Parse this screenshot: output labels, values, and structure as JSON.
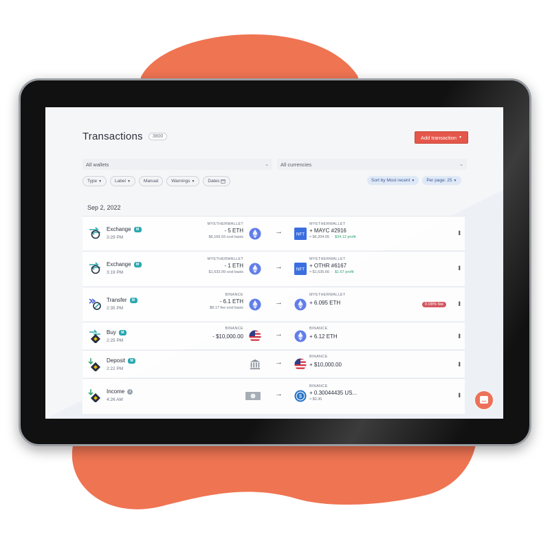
{
  "colors": {
    "blob": "#ef7452",
    "accent": "#e4574a",
    "teal": "#2aa8b0",
    "profit": "#2aa06e",
    "fee": "#d4545e"
  },
  "header": {
    "title": "Transactions",
    "count": "3800"
  },
  "add_button": {
    "label": "Add transaction"
  },
  "filters": {
    "wallets": "All wallets",
    "currencies": "All currencies",
    "chips": [
      "Type",
      "Label",
      "Manual",
      "Warnings",
      "Dates"
    ],
    "sort": "Sort by Most recent",
    "per_page": "Per page: 25"
  },
  "date_heading": "Sep 2, 2022",
  "transactions": [
    {
      "type": "Exchange",
      "badge": "M",
      "time": "3:29 PM",
      "icon": "exchange-icon",
      "src_wallet": "MYETHERWALLET",
      "src_amount": "- 5 ETH",
      "src_sub": "$6,169.93 cost basis",
      "src_coin": "eth-icon",
      "dst_wallet": "MYETHERWALLET",
      "dst_amount": "+ MAYC #2916",
      "dst_value": "≈ $6,204.05",
      "dst_profit": "$34.12 profit",
      "dst_coin": "nft-icon"
    },
    {
      "type": "Exchange",
      "badge": "M",
      "time": "3:19 PM",
      "icon": "exchange-icon",
      "src_wallet": "MYETHERWALLET",
      "src_amount": "- 1 ETH",
      "src_sub": "$1,633.99 cost basis",
      "src_coin": "eth-icon",
      "dst_wallet": "MYETHERWALLET",
      "dst_amount": "+ OTHR #6167",
      "dst_value": "≈ $1,635.66",
      "dst_profit": "$1.67 profit",
      "dst_coin": "nft-icon"
    },
    {
      "type": "Transfer",
      "badge": "M",
      "time": "2:35 PM",
      "icon": "transfer-icon",
      "src_wallet": "BINANCE",
      "src_amount": "- 6.1 ETH",
      "src_sub": "$8.17 fee cost basis",
      "src_coin": "eth-icon",
      "dst_wallet": "MYETHERWALLET",
      "dst_amount": "+ 6.095 ETH",
      "dst_coin": "eth-icon",
      "fee_badge": "0.08% fee"
    },
    {
      "type": "Buy",
      "badge": "M",
      "time": "2:25 PM",
      "icon": "buy-icon",
      "src_wallet": "BINANCE",
      "src_amount": "- $10,000.00",
      "src_coin": "usd-flag-icon",
      "dst_wallet": "BINANCE",
      "dst_amount": "+ 6.12 ETH",
      "dst_coin": "eth-icon"
    },
    {
      "type": "Deposit",
      "badge": "M",
      "time": "2:22 PM",
      "icon": "deposit-icon",
      "src_coin": "bank-icon",
      "dst_wallet": "BINANCE",
      "dst_amount": "+ $10,000.00",
      "dst_coin": "usd-flag-icon"
    },
    {
      "type": "Income",
      "badge": "i",
      "time": "4:26 AM",
      "icon": "income-icon",
      "src_coin": "cash-icon",
      "dst_wallet": "BINANCE",
      "dst_amount": "+ 0.30044435 US...",
      "dst_value": "≈ $0.30",
      "dst_coin": "usdc-icon"
    }
  ]
}
